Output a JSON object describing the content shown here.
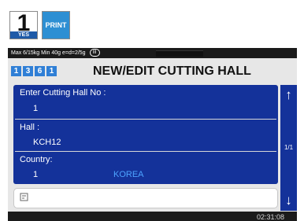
{
  "keys": {
    "one_num": "1",
    "one_sub": "YES",
    "print": "PRINT"
  },
  "status": {
    "spec": "Max 6/15kg Min 40g e=d=2/5g",
    "class": "III"
  },
  "menu_code": [
    "1",
    "3",
    "6",
    "1"
  ],
  "title": "NEW/EDIT CUTTING HALL",
  "fields": {
    "cutting_hall_no": {
      "label": "Enter Cutting Hall No :",
      "value": "1"
    },
    "hall": {
      "label": "Hall :",
      "value": "KCH12"
    },
    "country": {
      "label": "Country:",
      "value": "1",
      "name": "KOREA"
    }
  },
  "pager": {
    "up": "↑",
    "page": "1/1",
    "down": "↓"
  },
  "input": {
    "icon": "keyboard-icon",
    "value": ""
  },
  "clock": "02:31:08"
}
